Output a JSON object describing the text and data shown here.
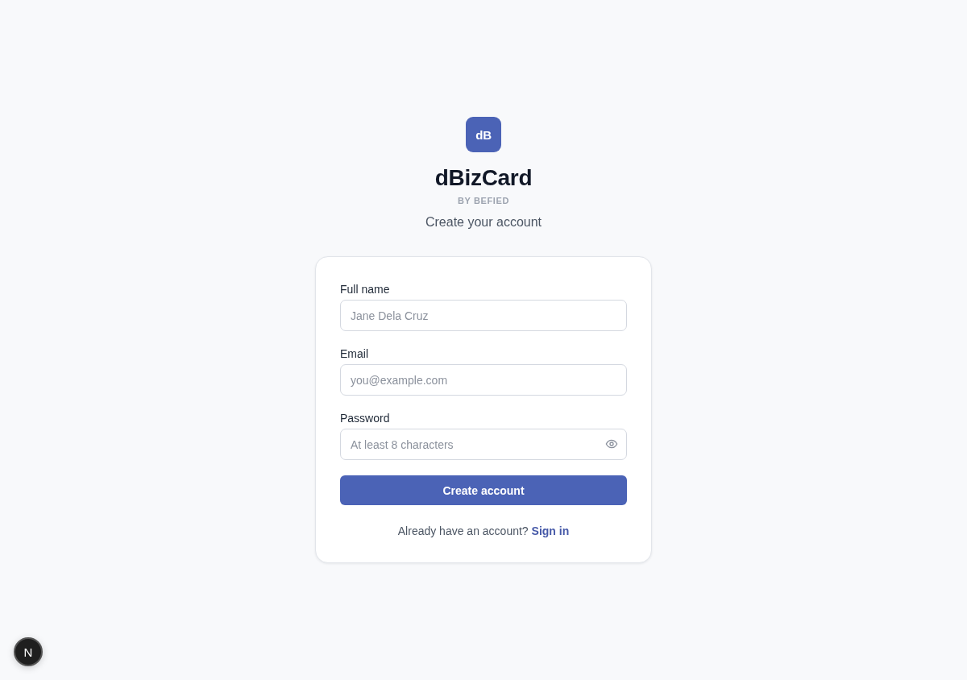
{
  "logo": {
    "text": "dB"
  },
  "app_name": "dBizCard",
  "byline": "BY BEFIED",
  "subtitle": "Create your account",
  "form": {
    "fields": [
      {
        "kind": "text",
        "label": "Full name",
        "placeholder": "Jane Dela Cruz"
      },
      {
        "kind": "email",
        "label": "Email",
        "placeholder": "you@example.com"
      },
      {
        "kind": "password",
        "label": "Password",
        "placeholder": "At least 8 characters"
      }
    ],
    "submit": "Create account",
    "footer": {
      "text": "Already have an account?",
      "link": "Sign in"
    }
  },
  "dev_badge": {
    "label": "N"
  }
}
